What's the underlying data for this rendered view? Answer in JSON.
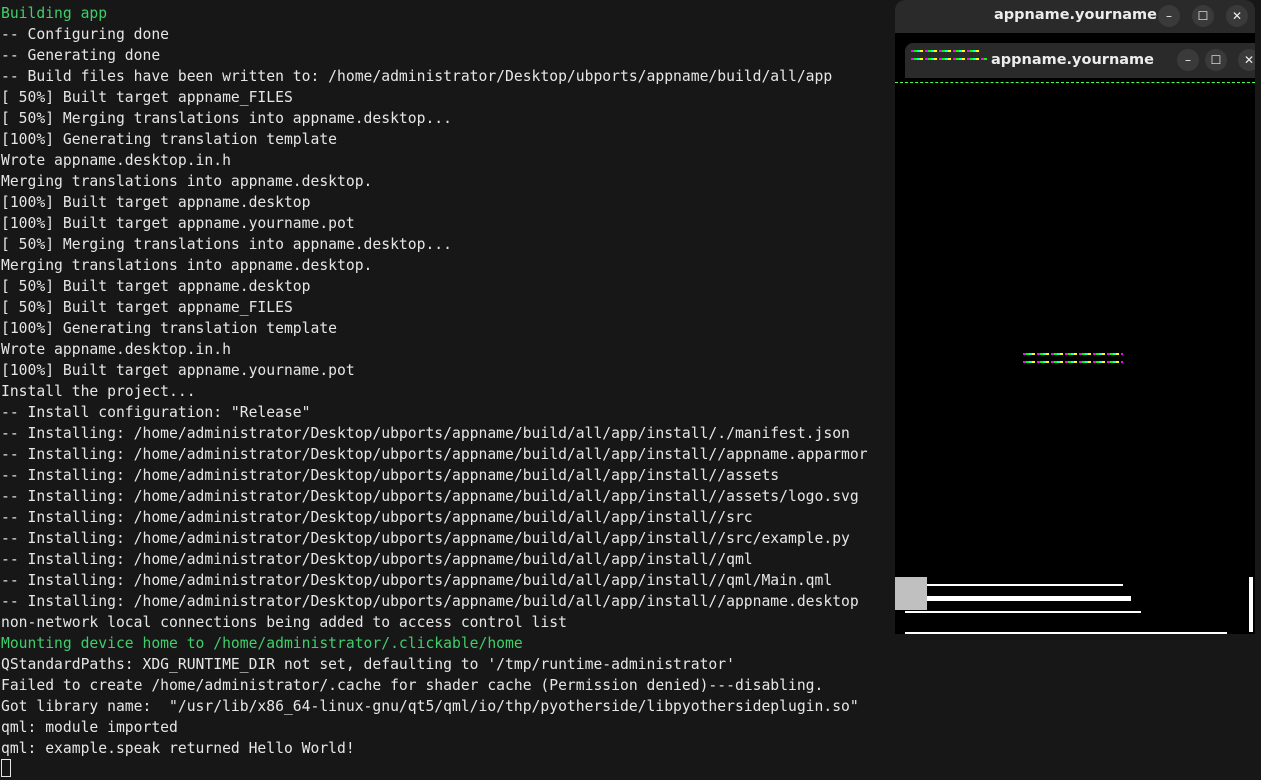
{
  "terminal": {
    "lines": [
      {
        "text": "Building app",
        "color": "green"
      },
      {
        "text": "-- Configuring done"
      },
      {
        "text": "-- Generating done"
      },
      {
        "text": "-- Build files have been written to: /home/administrator/Desktop/ubports/appname/build/all/app"
      },
      {
        "text": "[ 50%] Built target appname_FILES"
      },
      {
        "text": "[ 50%] Merging translations into appname.desktop..."
      },
      {
        "text": "[100%] Generating translation template"
      },
      {
        "text": "Wrote appname.desktop.in.h"
      },
      {
        "text": "Merging translations into appname.desktop."
      },
      {
        "text": "[100%] Built target appname.desktop"
      },
      {
        "text": "[100%] Built target appname.yourname.pot"
      },
      {
        "text": "[ 50%] Merging translations into appname.desktop..."
      },
      {
        "text": "Merging translations into appname.desktop."
      },
      {
        "text": "[ 50%] Built target appname.desktop"
      },
      {
        "text": "[ 50%] Built target appname_FILES"
      },
      {
        "text": "[100%] Generating translation template"
      },
      {
        "text": "Wrote appname.desktop.in.h"
      },
      {
        "text": "[100%] Built target appname.yourname.pot"
      },
      {
        "text": "Install the project..."
      },
      {
        "text": "-- Install configuration: \"Release\""
      },
      {
        "text": "-- Installing: /home/administrator/Desktop/ubports/appname/build/all/app/install/./manifest.json"
      },
      {
        "text": "-- Installing: /home/administrator/Desktop/ubports/appname/build/all/app/install//appname.apparmor"
      },
      {
        "text": "-- Installing: /home/administrator/Desktop/ubports/appname/build/all/app/install//assets"
      },
      {
        "text": "-- Installing: /home/administrator/Desktop/ubports/appname/build/all/app/install//assets/logo.svg"
      },
      {
        "text": "-- Installing: /home/administrator/Desktop/ubports/appname/build/all/app/install//src"
      },
      {
        "text": "-- Installing: /home/administrator/Desktop/ubports/appname/build/all/app/install//src/example.py"
      },
      {
        "text": "-- Installing: /home/administrator/Desktop/ubports/appname/build/all/app/install//qml"
      },
      {
        "text": "-- Installing: /home/administrator/Desktop/ubports/appname/build/all/app/install//qml/Main.qml"
      },
      {
        "text": "-- Installing: /home/administrator/Desktop/ubports/appname/build/all/app/install//appname.desktop"
      },
      {
        "text": "non-network local connections being added to access control list"
      },
      {
        "text": "Mounting device home to /home/administrator/.clickable/home",
        "color": "green"
      },
      {
        "text": "QStandardPaths: XDG_RUNTIME_DIR not set, defaulting to '/tmp/runtime-administrator'"
      },
      {
        "text": "Failed to create /home/administrator/.cache for shader cache (Permission denied)---disabling."
      },
      {
        "text": "Got library name:  \"/usr/lib/x86_64-linux-gnu/qt5/qml/io/thp/pyotherside/libpyothersideplugin.so\""
      },
      {
        "text": "qml: module imported"
      },
      {
        "text": "qml: example.speak returned Hello World!"
      }
    ]
  },
  "app_window": {
    "title": "appname.yourname",
    "inner_title": "appname.yourname",
    "buttons": {
      "minimize": "–",
      "maximize": "☐",
      "close": "✕"
    }
  },
  "colors": {
    "green": "#3fcf6a",
    "background": "#171717",
    "titlebar": "#2a2a2a"
  }
}
